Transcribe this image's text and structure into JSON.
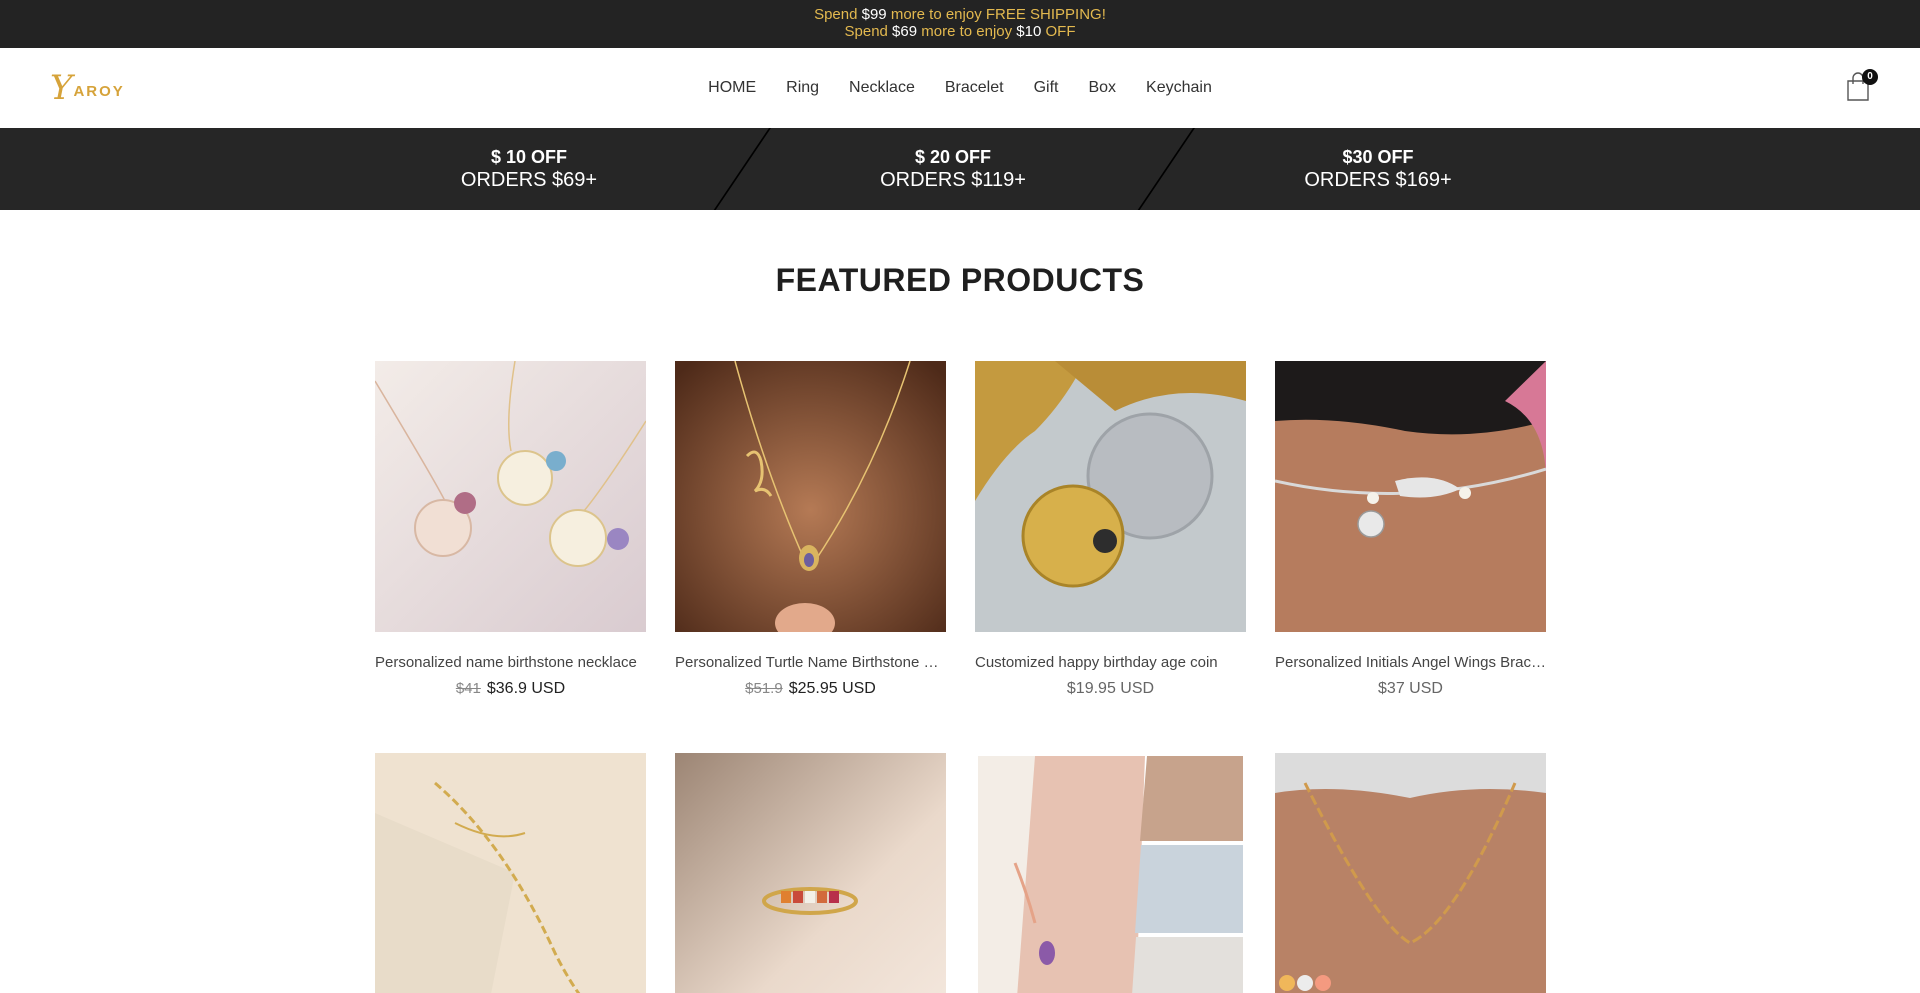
{
  "announcement": {
    "line1_prefix": "Spend ",
    "line1_amount": "$99",
    "line1_suffix": " more to enjoy FREE SHIPPING!",
    "line2_prefix": "Spend ",
    "line2_amount": "$69",
    "line2_middle": " more to enjoy ",
    "line2_amount2": "$10",
    "line2_suffix": " OFF"
  },
  "header": {
    "logo_mark": "Y",
    "logo_word": "AROY",
    "nav": [
      "HOME",
      "Ring",
      "Necklace",
      "Bracelet",
      "Gift",
      "Box",
      "Keychain"
    ],
    "cart_count": "0"
  },
  "promo": [
    {
      "title": "$ 10 OFF",
      "subtitle": "ORDERS $69+"
    },
    {
      "title": "$ 20 OFF",
      "subtitle": "ORDERS $119+"
    },
    {
      "title": "$30 OFF",
      "subtitle": "ORDERS $169+"
    }
  ],
  "section_title": "FEATURED PRODUCTS",
  "products": [
    {
      "name": "Personalized name birthstone necklace",
      "old_price": "$41",
      "price": "$36.9 USD"
    },
    {
      "name": "Personalized Turtle Name Birthstone Necklace",
      "old_price": "$51.9",
      "price": "$25.95 USD"
    },
    {
      "name": "Customized happy birthday age coin",
      "old_price": "",
      "price": "$19.95 USD"
    },
    {
      "name": "Personalized Initials Angel Wings Bracelet",
      "old_price": "",
      "price": "$37 USD"
    },
    {
      "name": "",
      "old_price": "",
      "price": ""
    },
    {
      "name": "",
      "old_price": "",
      "price": ""
    },
    {
      "name": "",
      "old_price": "",
      "price": ""
    },
    {
      "name": "",
      "old_price": "",
      "price": ""
    }
  ],
  "colors": {
    "accent_gold": "#e3b94f",
    "dark_bar": "#232323"
  }
}
